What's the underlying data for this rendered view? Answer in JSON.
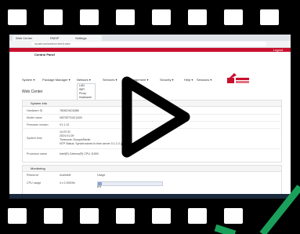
{
  "browser": {
    "tabs": [
      "Web Center",
      "RMSP",
      "Settings"
    ],
    "url": "localhost/webcenter/index"
  },
  "app": {
    "title": "Control Panel",
    "logout": "Logout"
  },
  "nav": {
    "items": [
      "System",
      "Package Manager",
      "Network",
      "Services",
      "Management",
      "Security",
      "Help",
      "Sessions"
    ]
  },
  "dropdown": {
    "items": [
      "LAN",
      "WiFi",
      "Proxy",
      "Hostname"
    ]
  },
  "page": {
    "heading": "Web Center"
  },
  "system_info": {
    "title": "System Info",
    "rows": [
      {
        "label": "Hardware ID",
        "value": "7826215C6388"
      },
      {
        "label": "Model name",
        "value": "N570E7G4C1A00"
      },
      {
        "label": "Firmware version",
        "value": "V1.1.12"
      },
      {
        "label": "System time",
        "value": "14:22:31"
      }
    ],
    "time_extra": [
      "2024-01-09",
      "Timezone: Europe/Berlin",
      "NTP Status: Synchronized to time server 0.1.2.3 (pool.ntp.org)"
    ],
    "processor": {
      "label": "Processor name",
      "value": "Intel(R) Celeron(R) CPU J1900"
    }
  },
  "monitoring": {
    "title": "Monitoring",
    "headers": [
      "Resource",
      "Available",
      "Usage"
    ],
    "cpu": {
      "label": "CPU usage",
      "available": "4 x 2.00GHz",
      "usage_pct": 6,
      "usage_text": "6%"
    }
  },
  "colors": {
    "brand_red": "#c8102e",
    "film": "#000000",
    "check_green": "#1aa05a"
  }
}
